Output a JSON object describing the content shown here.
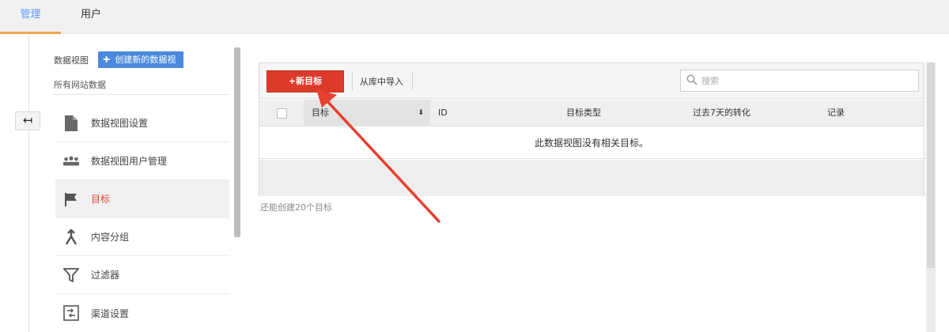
{
  "top_tabs": [
    {
      "label": "管理",
      "active": true
    },
    {
      "label": "用户",
      "active": false
    }
  ],
  "sidebar": {
    "view_label": "数据视图",
    "create_view_label": "创建新的数据视图",
    "view_name": "所有网站数据",
    "items": [
      {
        "label": "数据视图设置",
        "icon": "document-icon",
        "active": false
      },
      {
        "label": "数据视图用户管理",
        "icon": "users-icon",
        "active": false
      },
      {
        "label": "目标",
        "icon": "flag-icon",
        "active": true
      },
      {
        "label": "内容分组",
        "icon": "merge-icon",
        "active": false
      },
      {
        "label": "过滤器",
        "icon": "filter-icon",
        "active": false
      },
      {
        "label": "渠道设置",
        "icon": "channel-settings-icon",
        "active": false
      }
    ]
  },
  "toolbar": {
    "new_goal_label": "+新目标",
    "import_label": "从库中导入",
    "search_placeholder": "搜索"
  },
  "table": {
    "columns": [
      "目标",
      "ID",
      "目标类型",
      "过去7天的转化",
      "记录"
    ],
    "empty_message": "此数据视图没有相关目标。",
    "quota_note": "还能创建20个目标"
  },
  "colors": {
    "accent_blue": "#4a89dc",
    "tab_underline": "#f0a44b",
    "new_goal_red": "#dc3b2b",
    "arrow_red": "#e8402f"
  }
}
